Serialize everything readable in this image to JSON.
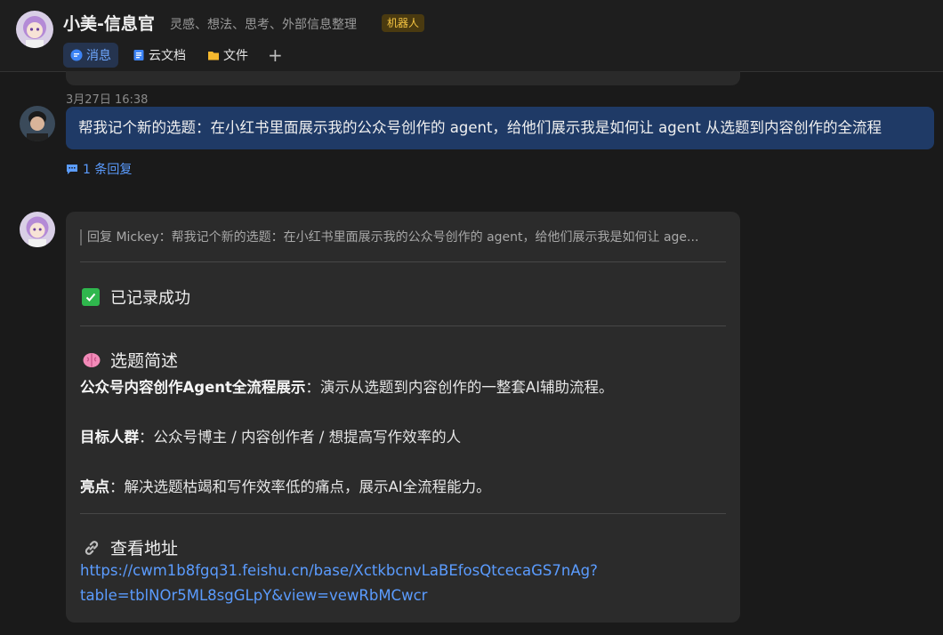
{
  "header": {
    "title": "小美-信息官",
    "description": "灵感、想法、思考、外部信息整理",
    "badge": "机器人",
    "tabs": [
      {
        "label": "消息",
        "icon": "message-icon"
      },
      {
        "label": "云文档",
        "icon": "doc-icon"
      },
      {
        "label": "文件",
        "icon": "folder-icon"
      }
    ],
    "add_tab": "+"
  },
  "messages": {
    "timestamp": "3月27日 16:38",
    "user_message": "帮我记个新的选题：在小红书里面展示我的公众号创作的 agent，给他们展示我是如何让 agent 从选题到内容创作的全流程",
    "reply_count": "1 条回复",
    "bot_card": {
      "quote": "回复 Mickey：帮我记个新的选题：在小红书里面展示我的公众号创作的 agent，给他们展示我是如何让 age...",
      "success": "已记录成功",
      "summary_title": "选题简述",
      "topic_label": "公众号内容创作Agent全流程展示",
      "topic_text": "：演示从选题到内容创作的一整套AI辅助流程。",
      "audience_label": "目标人群",
      "audience_text": "：公众号博主 / 内容创作者 / 想提高写作效率的人",
      "highlight_label": "亮点",
      "highlight_text": "：解决选题枯竭和写作效率低的痛点，展示AI全流程能力。",
      "link_title": "查看地址",
      "link_line1": "https://cwm1b8fgq31.feishu.cn/base/XctkbcnvLaBEfosQtcecaGS7nAg?",
      "link_line2": "table=tblNOr5ML8sgGLpY&view=vewRbMCwcr"
    }
  },
  "colors": {
    "accent": "#5b9cff",
    "user_bubble": "#1f3a66",
    "badge_bg": "#4a3a10",
    "badge_text": "#f5c542",
    "success": "#2fb74d"
  }
}
